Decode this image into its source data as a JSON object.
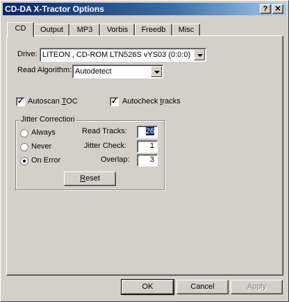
{
  "window": {
    "title": "CD-DA X-Tractor Options",
    "help_btn": "?",
    "close_btn": "x"
  },
  "tabs": [
    "CD",
    "Output",
    "MP3",
    "Vorbis",
    "Freedb",
    "Misc"
  ],
  "cd": {
    "drive_label": "Drive:",
    "drive_value": "LITEON  , CD-ROM LTN526S   vYS03 (0:0:0)",
    "read_algorithm_label": "Read Algorithm:",
    "read_algorithm_value": "Autodetect",
    "autoscan_toc_prefix": "Autoscan ",
    "autoscan_toc_u": "T",
    "autoscan_toc_suffix": "OC",
    "autoscan_toc_checked": true,
    "autocheck_prefix": "Autocheck ",
    "autocheck_u": "t",
    "autocheck_suffix": "racks",
    "autocheck_checked": true
  },
  "jitter": {
    "group_label": "Jitter Correction",
    "always": "Always",
    "never": "Never",
    "on_error": "On Error",
    "selected": "On Error",
    "read_tracks_label": "Read Tracks:",
    "read_tracks_value": "26",
    "jitter_check_label": "Jitter Check:",
    "jitter_check_value": "1",
    "overlap_label": "Overlap:",
    "overlap_value": "3",
    "reset_u": "R",
    "reset_rest": "eset"
  },
  "footer": {
    "ok": "OK",
    "cancel": "Cancel",
    "apply": "Apply"
  }
}
